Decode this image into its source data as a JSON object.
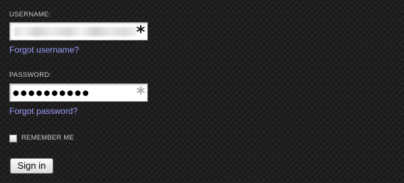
{
  "login": {
    "username_label": "USERNAME:",
    "username_required": "*",
    "forgot_username": "Forgot username?",
    "password_label": "PASSWORD:",
    "password_value": "●●●●●●●●●●",
    "password_required": "*",
    "forgot_password": "Forgot password?",
    "remember_label": "REMEMBER ME",
    "remember_checked": false,
    "sign_in_label": "Sign in"
  },
  "colors": {
    "background": "#1f1f1f",
    "label_text": "#c9c9c9",
    "link": "#9d9dff",
    "field_bg": "#ffffff"
  },
  "icons": {
    "username_required": "asterisk-icon",
    "password_required": "asterisk-icon"
  }
}
